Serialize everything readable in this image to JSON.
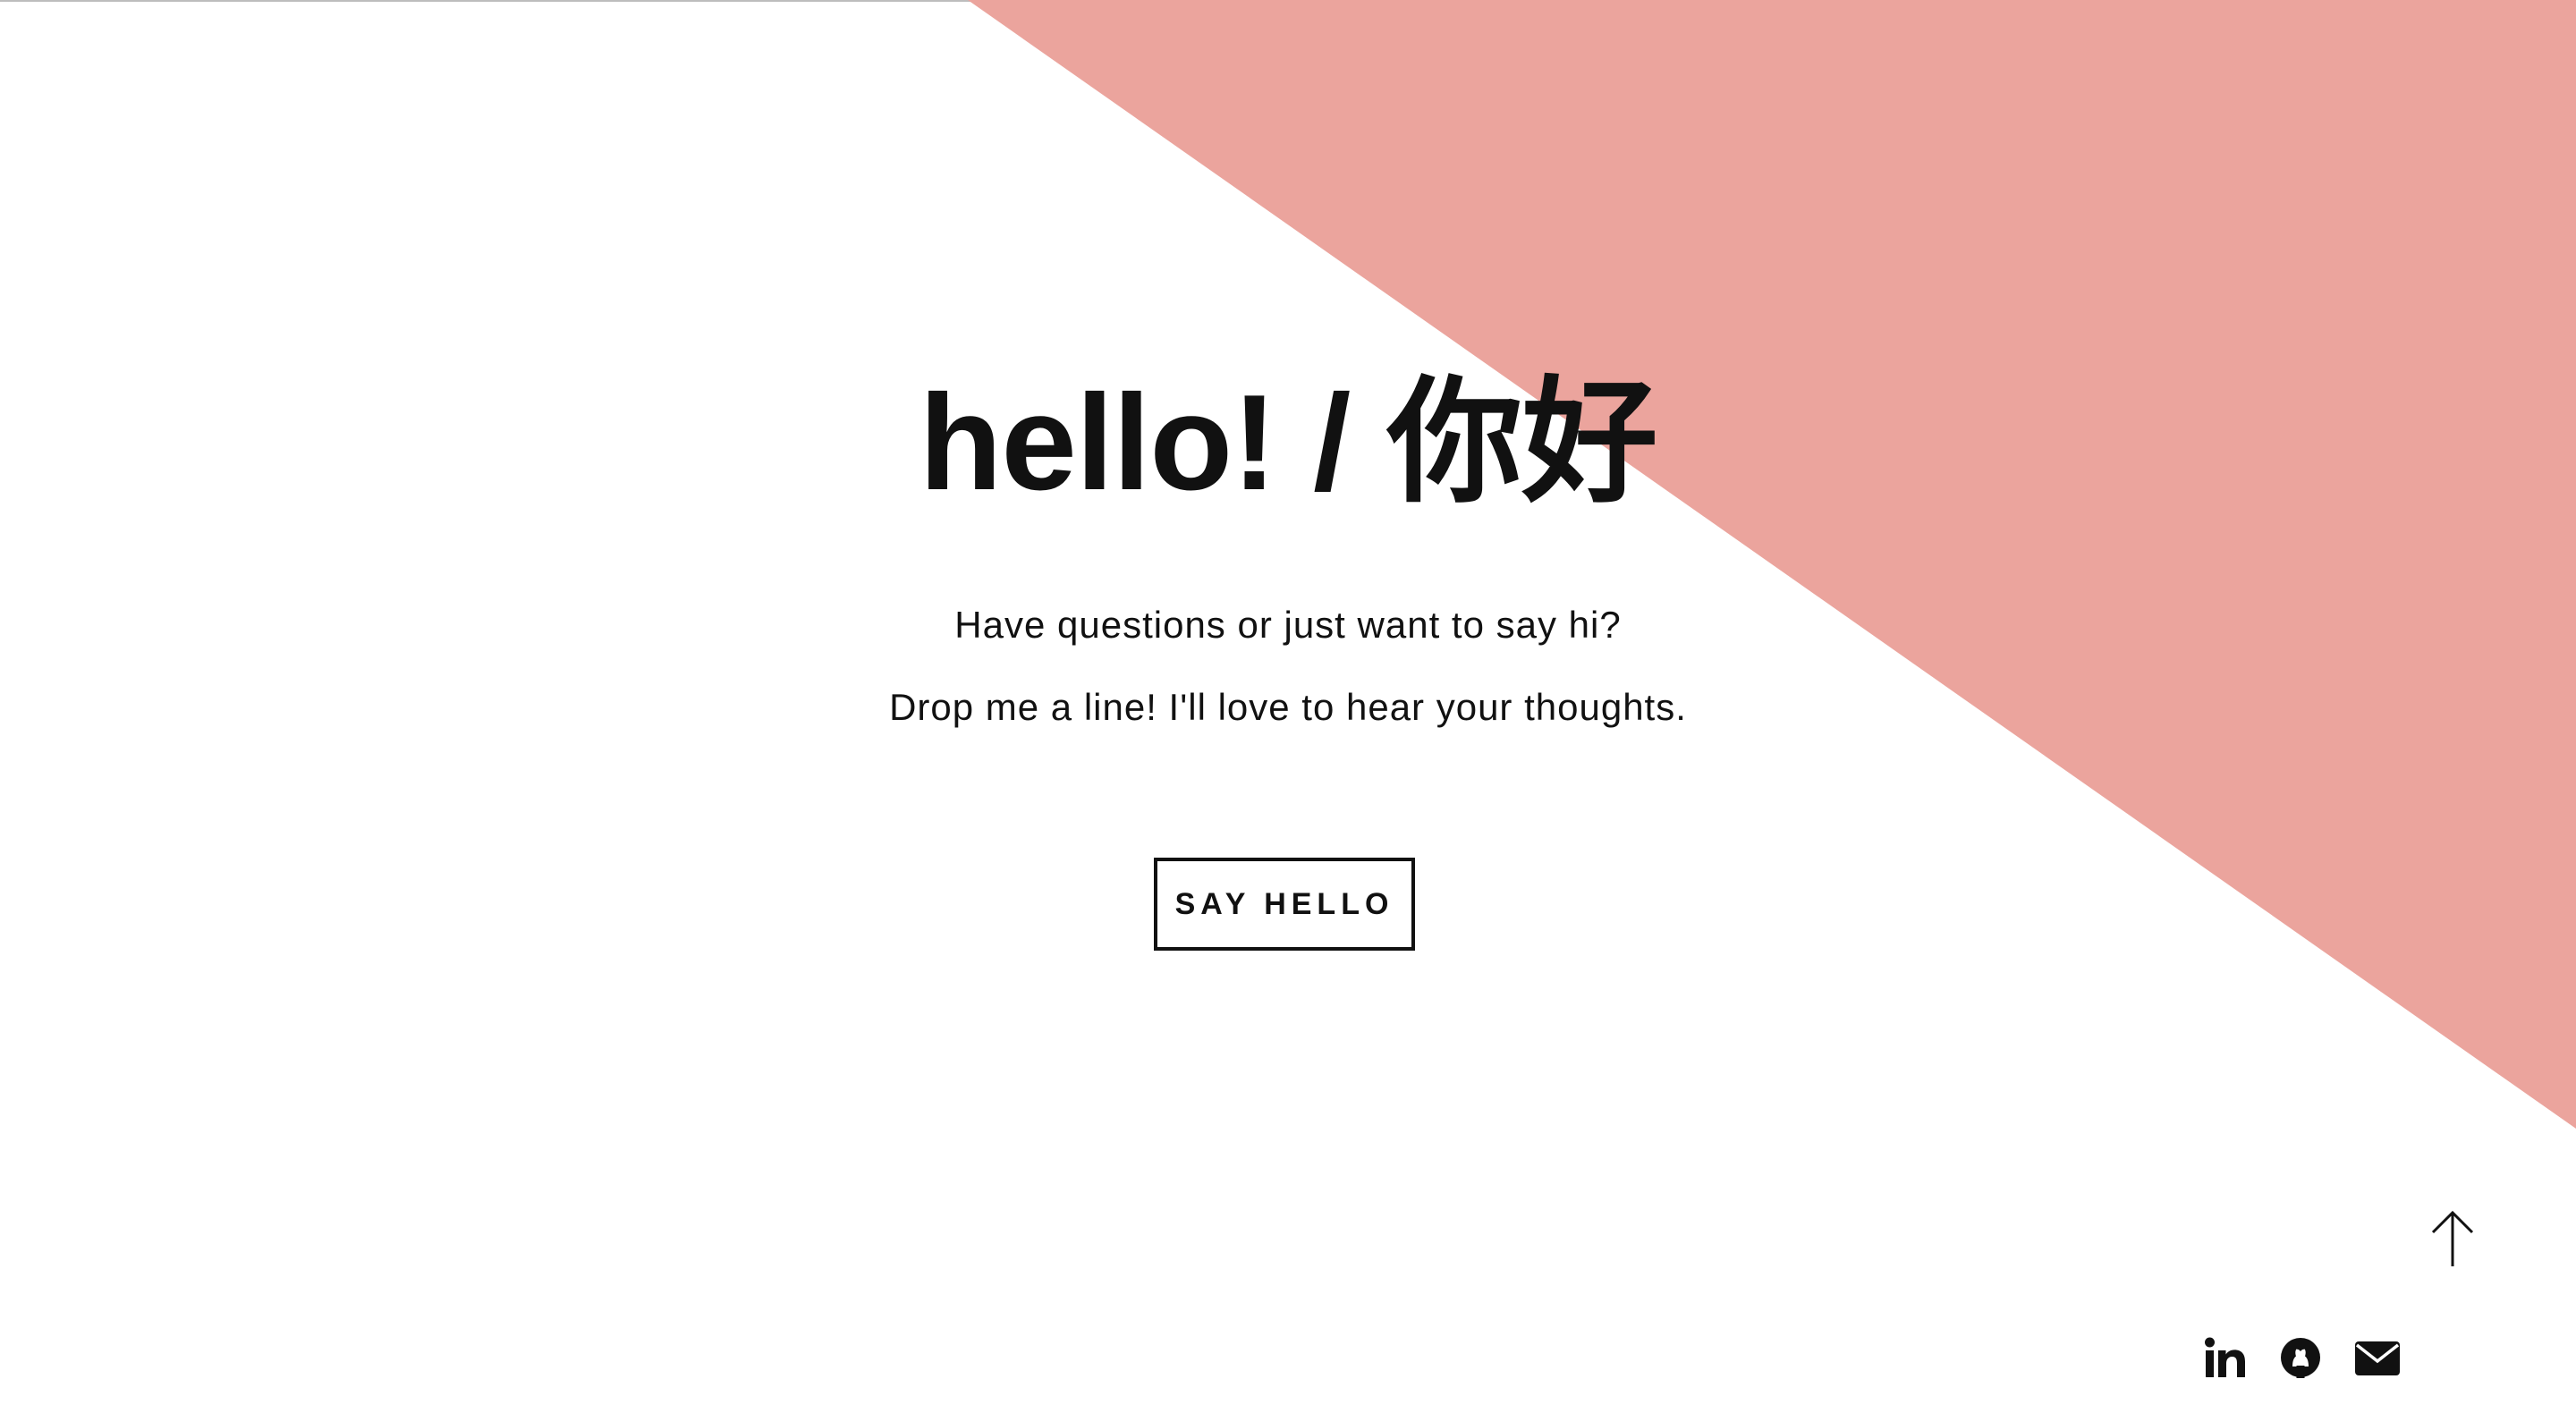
{
  "colors": {
    "background": "#ffffff",
    "accent_triangle": "#eba49d",
    "text": "#111111"
  },
  "hero": {
    "headline": "hello! / 你好",
    "line_1": "Have questions or just want to say hi?",
    "line_2": "Drop me a line! I'll love to hear your thoughts.",
    "cta_label": "SAY HELLO"
  },
  "footer": {
    "back_to_top_icon": "arrow-up-icon",
    "social_icons": [
      "linkedin-icon",
      "github-icon",
      "envelope-icon"
    ]
  }
}
